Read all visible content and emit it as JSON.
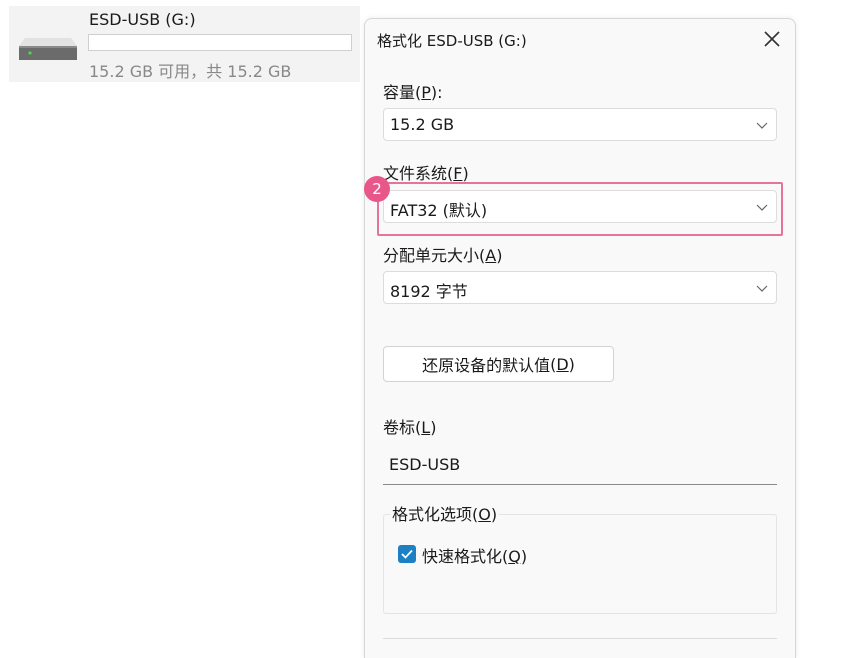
{
  "drive": {
    "name": "ESD-USB (G:)",
    "space": "15.2 GB 可用，共 15.2 GB",
    "usage_fraction": 0.0
  },
  "dialog": {
    "title": "格式化 ESD-USB (G:)",
    "capacity": {
      "label": "容量",
      "key": "P",
      "value": "15.2 GB"
    },
    "filesystem": {
      "label": "文件系统",
      "key": "F",
      "value": "FAT32 (默认)"
    },
    "allocation": {
      "label": "分配单元大小",
      "key": "A",
      "value": "8192 字节"
    },
    "restore_button": {
      "label": "还原设备的默认值",
      "key": "D"
    },
    "volume": {
      "label": "卷标",
      "key": "L",
      "value": "ESD-USB"
    },
    "options": {
      "label": "格式化选项",
      "key": "O",
      "quick_format": {
        "label": "快速格式化",
        "key": "Q",
        "checked": true
      }
    }
  },
  "annotation": {
    "step_number": "2",
    "color": "#e9578a"
  },
  "colors": {
    "accent": "#1d7fc4",
    "highlight": "#e6749a"
  }
}
